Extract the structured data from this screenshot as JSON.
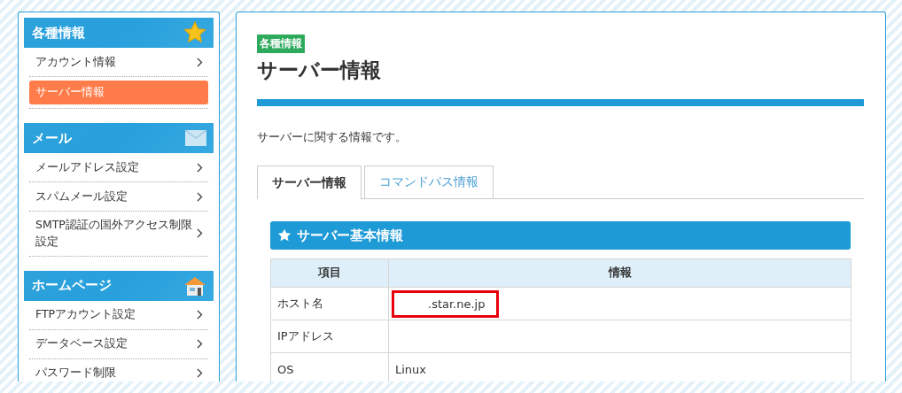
{
  "sidebar": {
    "sections": [
      {
        "title": "各種情報",
        "items": [
          {
            "label": "アカウント情報",
            "selected": false
          },
          {
            "label": "サーバー情報",
            "selected": true
          }
        ]
      },
      {
        "title": "メール",
        "items": [
          {
            "label": "メールアドレス設定",
            "selected": false
          },
          {
            "label": "スパムメール設定",
            "selected": false
          },
          {
            "label": "SMTP認証の国外アクセス制限設定",
            "selected": false
          }
        ]
      },
      {
        "title": "ホームページ",
        "items": [
          {
            "label": "FTPアカウント設定",
            "selected": false
          },
          {
            "label": "データベース設定",
            "selected": false
          },
          {
            "label": "パスワード制限",
            "selected": false
          }
        ]
      }
    ]
  },
  "main": {
    "badge": "各種情報",
    "title": "サーバー情報",
    "description": "サーバーに関する情報です。",
    "tabs": [
      {
        "label": "サーバー情報",
        "selected": true
      },
      {
        "label": "コマンドパス情報",
        "selected": false
      }
    ],
    "section_title": "サーバー基本情報",
    "table": {
      "columns": [
        "項目",
        "情報"
      ],
      "rows": [
        {
          "item": "ホスト名",
          "value": ".star.ne.jp",
          "highlighted": true
        },
        {
          "item": "IPアドレス",
          "highlighted": false
        },
        {
          "item": "OS",
          "value": "Linux",
          "highlighted": false
        }
      ]
    }
  }
}
